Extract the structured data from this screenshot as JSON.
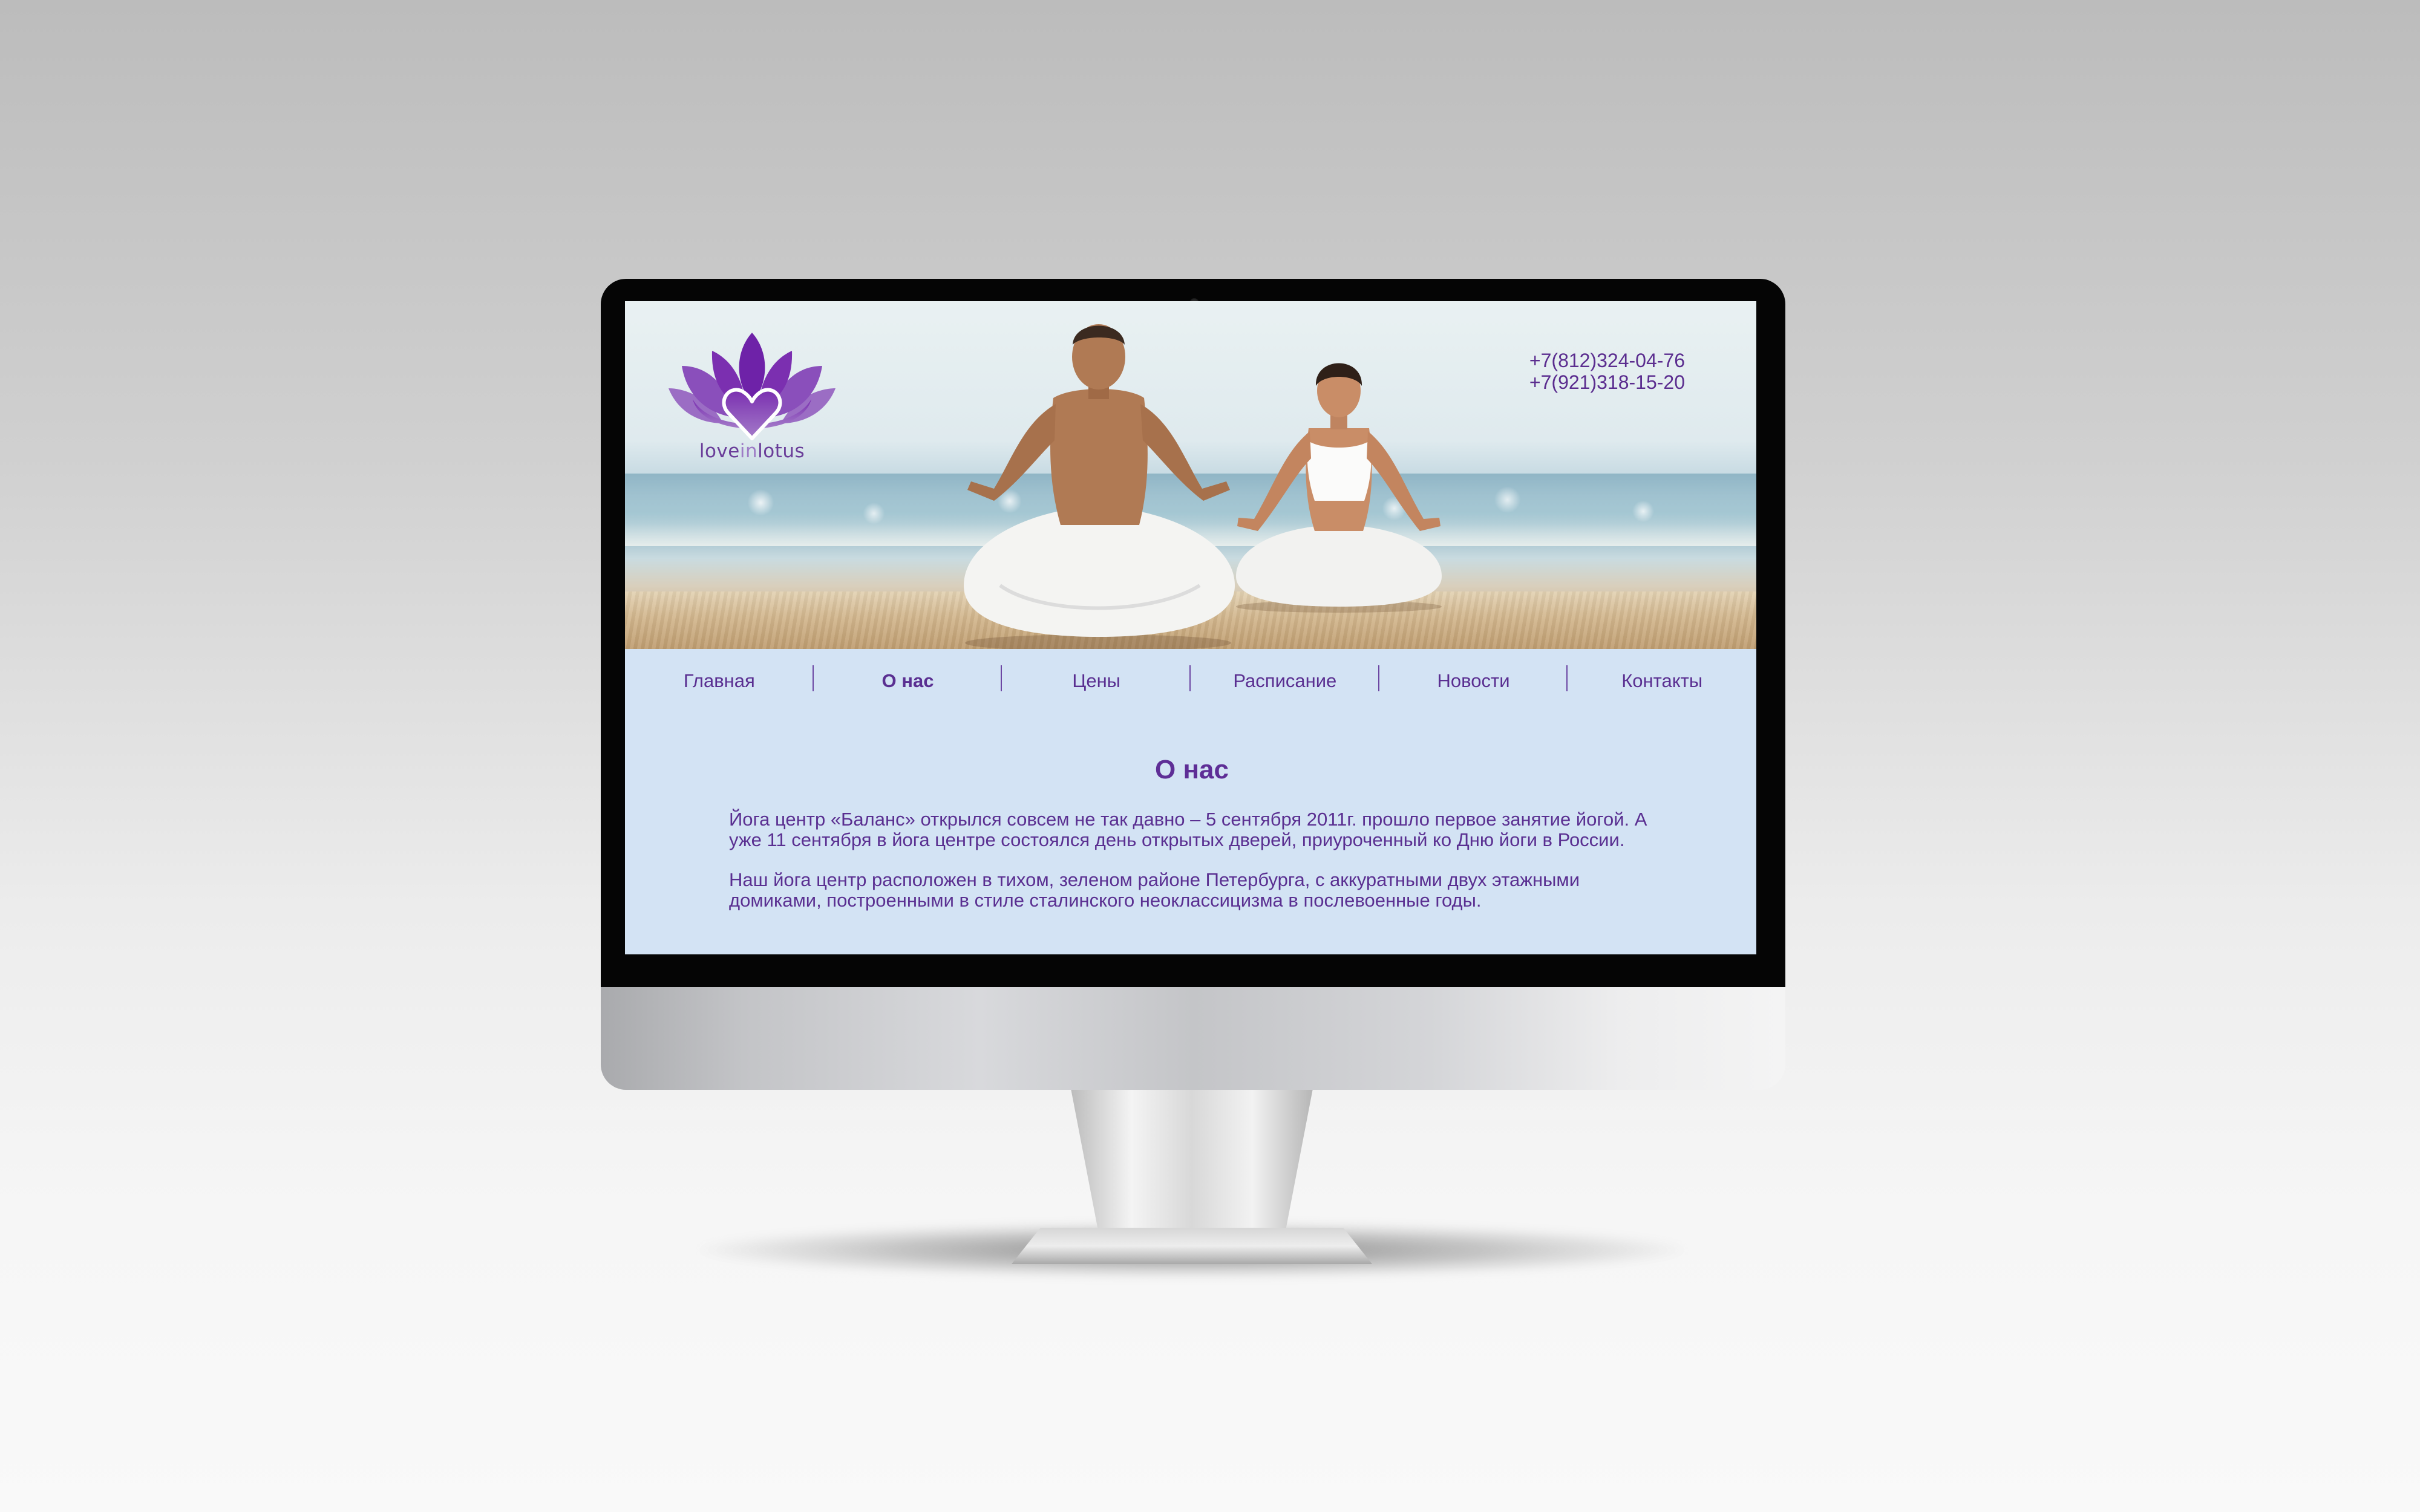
{
  "site": {
    "logo_text_prefix": "love",
    "logo_text_accent": "in",
    "logo_text_suffix": "lotus"
  },
  "contacts": {
    "phones": [
      "+7(812)324-04-76",
      "+7(921)318-15-20"
    ]
  },
  "nav": {
    "items": [
      {
        "label": "Главная",
        "active": false
      },
      {
        "label": "О нас",
        "active": true
      },
      {
        "label": "Цены",
        "active": false
      },
      {
        "label": "Расписание",
        "active": false
      },
      {
        "label": "Новости",
        "active": false
      },
      {
        "label": "Контакты",
        "active": false
      }
    ]
  },
  "page": {
    "title": "О нас",
    "paragraphs": [
      "Йога центр «Баланс» открылся совсем не так давно – 5 сентября 2011г. прошло первое занятие йогой. А уже 11 сентября в йога центре состоялся день открытых дверей, приуроченный ко Дню йоги в России.",
      "Наш йога центр расположен в тихом, зеленом районе Петербурга, с аккуратными двух этажными домиками, построенными в стиле сталинского неоклассицизма в послевоенные годы."
    ]
  },
  "theme": {
    "accent": "#5e2e96",
    "screen_background": "#d3e3f4",
    "bezel": "#050505"
  }
}
